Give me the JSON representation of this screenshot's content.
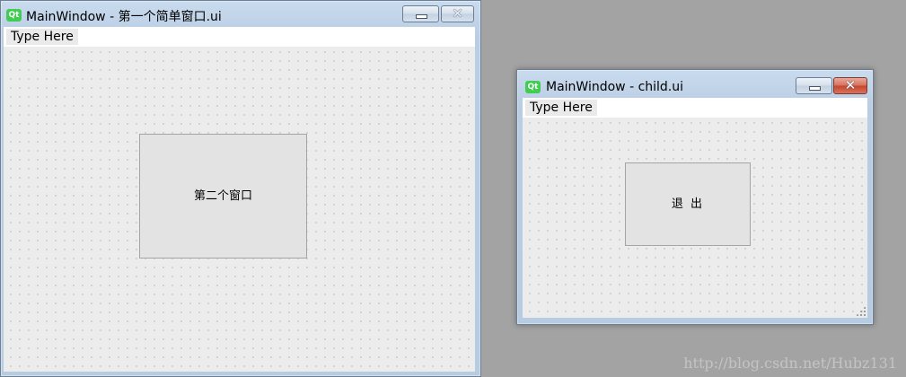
{
  "colors": {
    "desktop": "#a3a3a3",
    "title_bar": "#b9cde3",
    "qt_logo": "#41cd52",
    "close_button_active": "#c4442c",
    "client_background": "#ececec",
    "button_face": "#e3e3e3"
  },
  "windows": [
    {
      "app_icon": "Qt",
      "title": "MainWindow - 第一个简单窗口.ui",
      "controls": {
        "minimize_icon": "minimize-icon",
        "close_icon": "close-icon",
        "close_symbol": "✕"
      },
      "menubar": {
        "item_label": "Type Here"
      },
      "button": {
        "label": "第二个窗口"
      }
    },
    {
      "app_icon": "Qt",
      "title": "MainWindow - child.ui",
      "controls": {
        "minimize_icon": "minimize-icon",
        "close_icon": "close-icon",
        "close_symbol": "✕"
      },
      "menubar": {
        "item_label": "Type Here"
      },
      "button": {
        "label": "退  出"
      }
    }
  ],
  "watermark": "http://blog.csdn.net/Hubz131"
}
